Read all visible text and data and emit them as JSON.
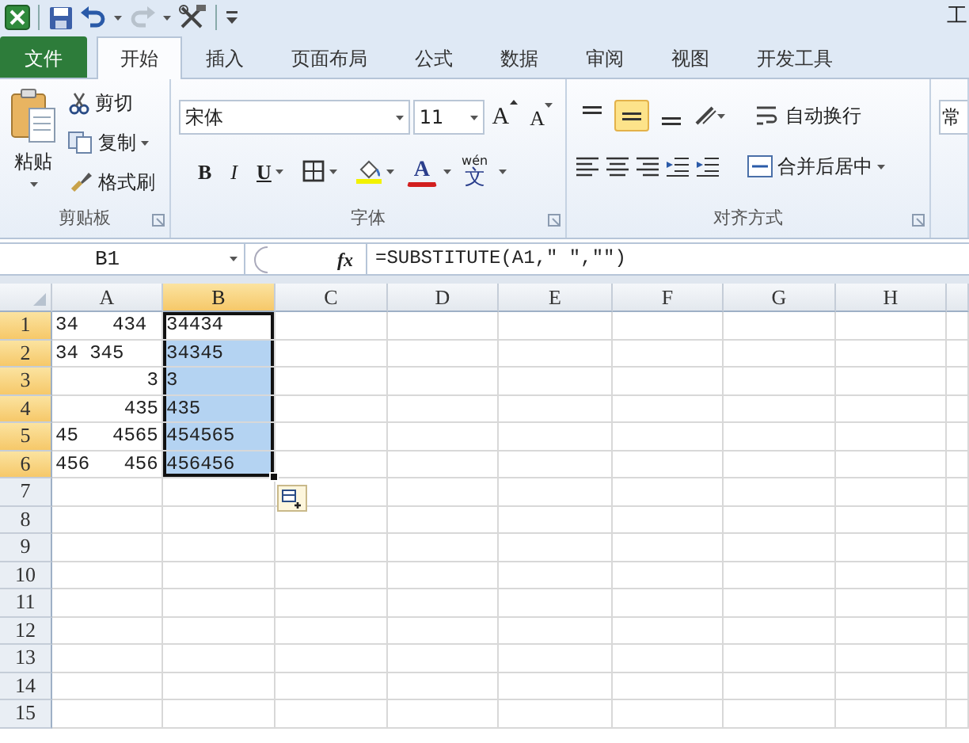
{
  "window": {
    "title": "工"
  },
  "tabs": [
    {
      "label": "文件",
      "kind": "file",
      "selected": false
    },
    {
      "label": "开始",
      "kind": "tab",
      "selected": true
    },
    {
      "label": "插入",
      "kind": "tab",
      "selected": false
    },
    {
      "label": "页面布局",
      "kind": "tab",
      "selected": false
    },
    {
      "label": "公式",
      "kind": "tab",
      "selected": false
    },
    {
      "label": "数据",
      "kind": "tab",
      "selected": false
    },
    {
      "label": "审阅",
      "kind": "tab",
      "selected": false
    },
    {
      "label": "视图",
      "kind": "tab",
      "selected": false
    },
    {
      "label": "开发工具",
      "kind": "tab",
      "selected": false
    }
  ],
  "ribbon": {
    "clipboard": {
      "title": "剪贴板",
      "paste": "粘贴",
      "cut": "剪切",
      "copy": "复制",
      "format_painter": "格式刷"
    },
    "font": {
      "title": "字体",
      "font_name": "宋体",
      "font_size": "11",
      "grow": "A",
      "shrink": "A",
      "bold": "B",
      "italic": "I",
      "underline": "U",
      "font_color": "A",
      "phonetic_ruby": "wén",
      "phonetic_char": "文"
    },
    "alignment": {
      "title": "对齐方式",
      "vertical": [
        {
          "kind": "top",
          "selected": false
        },
        {
          "kind": "middle",
          "selected": true
        },
        {
          "kind": "bottom",
          "selected": false
        }
      ],
      "wrap_text": "自动换行",
      "merge_center": "合并后居中"
    },
    "number": {
      "format": "常"
    }
  },
  "formula_bar": {
    "name_box": "B1",
    "fx": "fx",
    "formula": "=SUBSTITUTE(A1,\" \",\"\")"
  },
  "columns": [
    {
      "label": "A",
      "selected": false
    },
    {
      "label": "B",
      "selected": true
    },
    {
      "label": "C",
      "selected": false
    },
    {
      "label": "D",
      "selected": false
    },
    {
      "label": "E",
      "selected": false
    },
    {
      "label": "F",
      "selected": false
    },
    {
      "label": "G",
      "selected": false
    },
    {
      "label": "H",
      "selected": false
    }
  ],
  "rows": [
    {
      "label": "1",
      "selected": true,
      "cells": [
        {
          "text": "34   434",
          "kind": "text",
          "selected": false,
          "active": false
        },
        {
          "text": "34434",
          "kind": "text",
          "selected": true,
          "active": true
        }
      ]
    },
    {
      "label": "2",
      "selected": true,
      "cells": [
        {
          "text": "34 345",
          "kind": "text",
          "selected": false,
          "active": false
        },
        {
          "text": "34345",
          "kind": "text",
          "selected": true,
          "active": false
        }
      ]
    },
    {
      "label": "3",
      "selected": true,
      "cells": [
        {
          "text": "3",
          "kind": "number",
          "selected": false,
          "active": false
        },
        {
          "text": "3",
          "kind": "text",
          "selected": true,
          "active": false
        }
      ]
    },
    {
      "label": "4",
      "selected": true,
      "cells": [
        {
          "text": "435",
          "kind": "number",
          "selected": false,
          "active": false
        },
        {
          "text": "435",
          "kind": "text",
          "selected": true,
          "active": false
        }
      ]
    },
    {
      "label": "5",
      "selected": true,
      "cells": [
        {
          "text": "45   4565",
          "kind": "text",
          "selected": false,
          "active": false
        },
        {
          "text": "454565",
          "kind": "text",
          "selected": true,
          "active": false
        }
      ]
    },
    {
      "label": "6",
      "selected": true,
      "cells": [
        {
          "text": "456   456",
          "kind": "text",
          "selected": false,
          "active": false
        },
        {
          "text": "456456",
          "kind": "text",
          "selected": true,
          "active": false
        }
      ]
    },
    {
      "label": "7",
      "selected": false
    },
    {
      "label": "8",
      "selected": false
    },
    {
      "label": "9",
      "selected": false
    },
    {
      "label": "10",
      "selected": false
    },
    {
      "label": "11",
      "selected": false
    },
    {
      "label": "12",
      "selected": false
    },
    {
      "label": "13",
      "selected": false
    },
    {
      "label": "14",
      "selected": false
    },
    {
      "label": "15",
      "selected": false
    }
  ]
}
